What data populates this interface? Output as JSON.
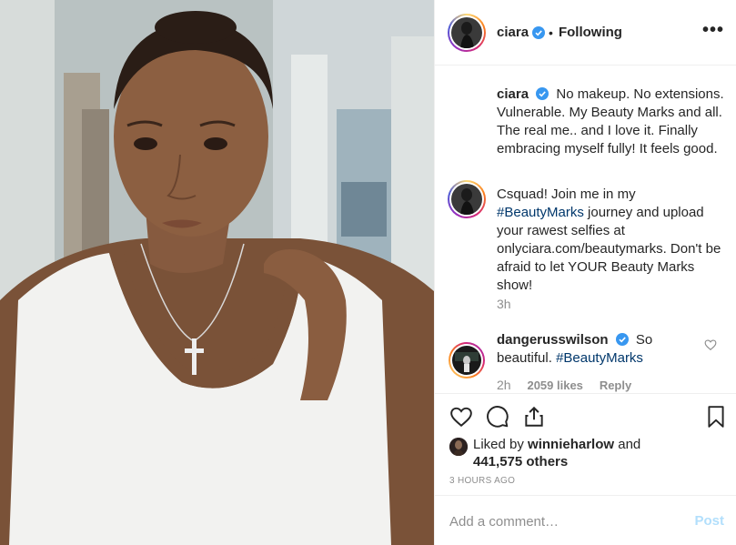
{
  "post": {
    "username": "ciara",
    "separator": "•",
    "follow_status": "Following",
    "more_label": "•••"
  },
  "caption": {
    "username": "ciara",
    "text": "No makeup. No extensions. Vulnerable. My Beauty Marks and all. The real me.. and I love it. Finally embracing myself fully! It feels good."
  },
  "comment_owner": {
    "text_before": "Csquad! Join me in my ",
    "hashtag": "#BeautyMarks",
    "text_after": " journey and upload your rawest selfies at onlyciara.com/beautymarks. Don't be afraid to let YOUR Beauty Marks show!",
    "time": "3h"
  },
  "comment_reply": {
    "username": "dangerusswilson",
    "text": "So beautiful.",
    "hashtag": "#BeautyMarks",
    "time": "2h",
    "likes": "2059 likes",
    "reply_label": "Reply"
  },
  "actions": {
    "liked_by_prefix": "Liked by",
    "liked_by_user": "winnieharlow",
    "liked_by_and": "and",
    "others_count": "441,575 others",
    "timestamp": "3 HOURS AGO"
  },
  "add_comment": {
    "placeholder": "Add a comment…",
    "post_label": "Post"
  },
  "icons": {
    "verified": "verified-badge-icon",
    "like": "heart-icon",
    "comment": "comment-bubble-icon",
    "share": "share-icon",
    "save": "bookmark-icon",
    "more": "more-options-icon"
  },
  "colors": {
    "verified_blue": "#3897f0",
    "link": "#00376b",
    "muted": "#8e8e8e",
    "post_disabled": "#b2dffc"
  }
}
